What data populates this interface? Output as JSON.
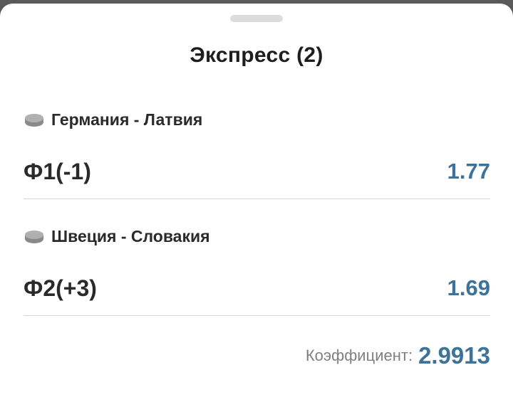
{
  "sheet": {
    "title": "Экспресс (2)"
  },
  "bets": [
    {
      "event": "Германия - Латвия",
      "event_icon": "hockey-puck-icon",
      "outcome": "Ф1(-1)",
      "odds": "1.77"
    },
    {
      "event": "Швеция - Словакия",
      "event_icon": "hockey-puck-icon",
      "outcome": "Ф2(+3)",
      "odds": "1.69"
    }
  ],
  "total": {
    "label": "Коэффициент:",
    "value": "2.9913"
  },
  "colors": {
    "accent": "#3d7399",
    "text": "#2a2a2a",
    "muted": "#808080",
    "divider": "#d6d6d6"
  }
}
